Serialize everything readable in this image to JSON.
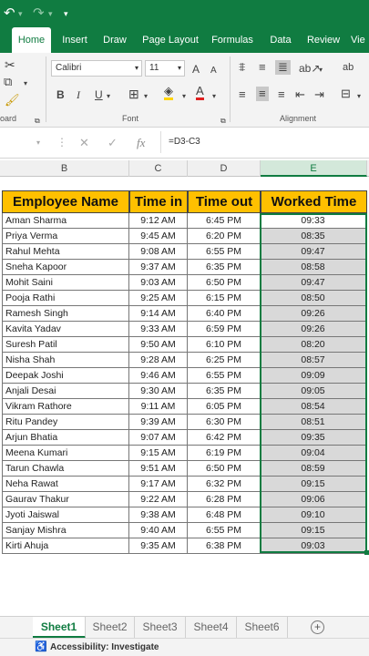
{
  "titlebar": {
    "undo_icon": "undo-icon",
    "redo_icon": "redo-icon",
    "customize_icon": "customize-icon"
  },
  "tabs": [
    "Home",
    "Insert",
    "Draw",
    "Page Layout",
    "Formulas",
    "Data",
    "Review",
    "Vie"
  ],
  "ribbon": {
    "font_name": "Calibri",
    "font_size": "11",
    "grow_font": "A",
    "shrink_font": "A",
    "bold": "B",
    "italic": "I",
    "underline": "U",
    "font_color_letter": "A",
    "wrap_text": "ab",
    "orientation": "ab",
    "groups": {
      "clipboard": "oard",
      "font": "Font",
      "alignment": "Alignment"
    }
  },
  "formula_bar": {
    "cancel": "✕",
    "enter": "✓",
    "fx": "fx",
    "formula": "=D3-C3"
  },
  "columns": [
    "B",
    "C",
    "D",
    "E"
  ],
  "table": {
    "headers": [
      "Employee Name",
      "Time in",
      "Time out",
      "Worked Time"
    ],
    "rows": [
      [
        "Aman Sharma",
        "9:12 AM",
        "6:45 PM",
        "09:33"
      ],
      [
        "Priya Verma",
        "9:45 AM",
        "6:20 PM",
        "08:35"
      ],
      [
        "Rahul Mehta",
        "9:08 AM",
        "6:55 PM",
        "09:47"
      ],
      [
        "Sneha Kapoor",
        "9:37 AM",
        "6:35 PM",
        "08:58"
      ],
      [
        "Mohit Saini",
        "9:03 AM",
        "6:50 PM",
        "09:47"
      ],
      [
        "Pooja Rathi",
        "9:25 AM",
        "6:15 PM",
        "08:50"
      ],
      [
        "Ramesh Singh",
        "9:14 AM",
        "6:40 PM",
        "09:26"
      ],
      [
        "Kavita Yadav",
        "9:33 AM",
        "6:59 PM",
        "09:26"
      ],
      [
        "Suresh Patil",
        "9:50 AM",
        "6:10 PM",
        "08:20"
      ],
      [
        "Nisha Shah",
        "9:28 AM",
        "6:25 PM",
        "08:57"
      ],
      [
        "Deepak Joshi",
        "9:46 AM",
        "6:55 PM",
        "09:09"
      ],
      [
        "Anjali Desai",
        "9:30 AM",
        "6:35 PM",
        "09:05"
      ],
      [
        "Vikram Rathore",
        "9:11 AM",
        "6:05 PM",
        "08:54"
      ],
      [
        "Ritu Pandey",
        "9:39 AM",
        "6:30 PM",
        "08:51"
      ],
      [
        "Arjun Bhatia",
        "9:07 AM",
        "6:42 PM",
        "09:35"
      ],
      [
        "Meena Kumari",
        "9:15 AM",
        "6:19 PM",
        "09:04"
      ],
      [
        "Tarun Chawla",
        "9:51 AM",
        "6:50 PM",
        "08:59"
      ],
      [
        "Neha Rawat",
        "9:17 AM",
        "6:32 PM",
        "09:15"
      ],
      [
        "Gaurav Thakur",
        "9:22 AM",
        "6:28 PM",
        "09:06"
      ],
      [
        "Jyoti Jaiswal",
        "9:38 AM",
        "6:48 PM",
        "09:10"
      ],
      [
        "Sanjay Mishra",
        "9:40 AM",
        "6:55 PM",
        "09:15"
      ],
      [
        "Kirti Ahuja",
        "9:35 AM",
        "6:38 PM",
        "09:03"
      ]
    ]
  },
  "sheets": [
    "Sheet1",
    "Sheet2",
    "Sheet3",
    "Sheet4",
    "Sheet6"
  ],
  "active_sheet": "Sheet1",
  "status": {
    "accessibility": "Accessibility: Investigate"
  },
  "colors": {
    "accent": "#107c41",
    "header_fill": "#ffc000",
    "selected_fill": "#d9d9d9"
  }
}
